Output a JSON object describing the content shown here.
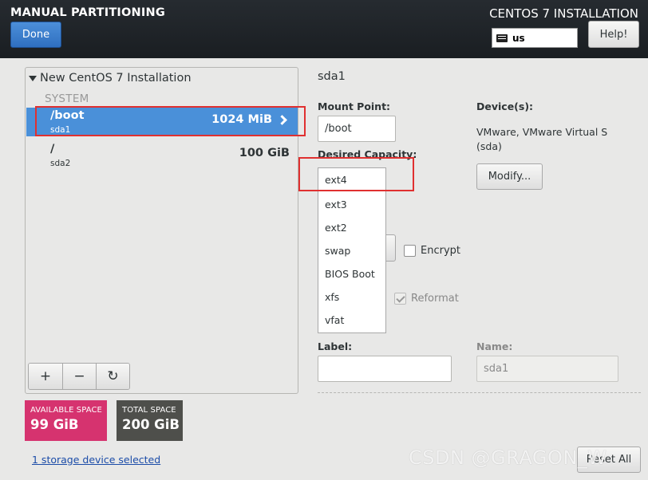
{
  "header": {
    "title": "MANUAL PARTITIONING",
    "done_label": "Done",
    "install_title": "CENTOS 7 INSTALLATION",
    "keyboard_layout": "us",
    "help_label": "Help!"
  },
  "left_panel": {
    "installation_title": "New CentOS 7 Installation",
    "group_label": "SYSTEM",
    "partitions": [
      {
        "mount_point": "/boot",
        "device": "sda1",
        "size": "1024 MiB",
        "selected": true
      },
      {
        "mount_point": "/",
        "device": "sda2",
        "size": "100 GiB",
        "selected": false
      }
    ],
    "add_label": "+",
    "remove_label": "−",
    "reload_label": "↻"
  },
  "space": {
    "available_label": "AVAILABLE SPACE",
    "available_value": "99 GiB",
    "total_label": "TOTAL SPACE",
    "total_value": "200 GiB",
    "storage_link": "1 storage device selected"
  },
  "detail": {
    "title": "sda1",
    "mount_point_label": "Mount Point:",
    "mount_point_value": "/boot",
    "desired_capacity_label": "Desired Capacity:",
    "devices_label": "Device(s):",
    "devices_value": "VMware, VMware Virtual S (sda)",
    "modify_label": "Modify...",
    "encrypt_label": "Encrypt",
    "encrypt_checked": false,
    "reformat_label": "Reformat",
    "reformat_checked": true,
    "label_label": "Label:",
    "label_value": "",
    "name_label": "Name:",
    "name_value": "sda1",
    "filesystem_options": [
      "ext4",
      "ext3",
      "ext2",
      "swap",
      "BIOS Boot",
      "xfs",
      "vfat"
    ],
    "reset_label": "Reset All"
  },
  "watermark": "CSDN @GRAGON_W",
  "colors": {
    "header_bg": "#1a1e22",
    "selected_row": "#4a90d9",
    "available_bg": "#d6336f",
    "total_bg": "#4e4f4b",
    "highlight_box": "#e03030"
  }
}
